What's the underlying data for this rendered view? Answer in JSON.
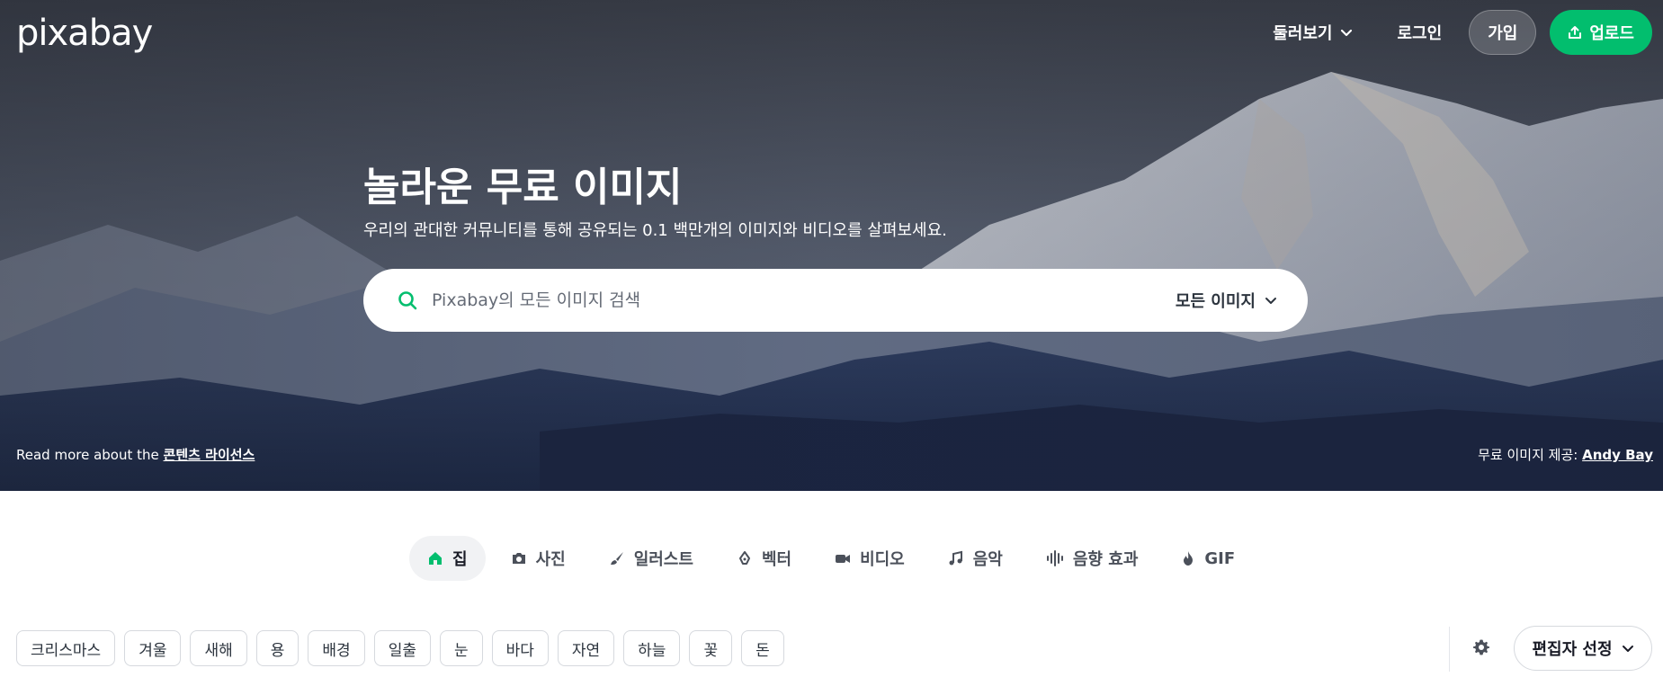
{
  "brand": {
    "logo_text": "pixabay"
  },
  "nav": {
    "explore_label": "둘러보기",
    "login_label": "로그인",
    "join_label": "가입",
    "upload_label": "업로드"
  },
  "hero": {
    "title": "놀라운 무료 이미지",
    "subtitle": "우리의 관대한 커뮤니티를 통해 공유되는 0.1 백만개의 이미지와 비디오를 살펴보세요.",
    "search": {
      "placeholder": "Pixabay의 모든 이미지 검색",
      "value": "",
      "type_selector": "모든 이미지"
    },
    "license_prefix": "Read more about the",
    "license_link": "콘텐츠 라이선스",
    "photo_credit_prefix": "무료 이미지 제공:",
    "photo_credit_author": "Andy Bay"
  },
  "tabs": [
    {
      "label": "집",
      "icon": "home-icon",
      "active": true
    },
    {
      "label": "사진",
      "icon": "camera-icon",
      "active": false
    },
    {
      "label": "일러스트",
      "icon": "brush-icon",
      "active": false
    },
    {
      "label": "벡터",
      "icon": "pen-nib-icon",
      "active": false
    },
    {
      "label": "비디오",
      "icon": "video-icon",
      "active": false
    },
    {
      "label": "음악",
      "icon": "music-note-icon",
      "active": false
    },
    {
      "label": "음향 효과",
      "icon": "sound-wave-icon",
      "active": false
    },
    {
      "label": "GIF",
      "icon": "flame-icon",
      "active": false
    }
  ],
  "chips": [
    "크리스마스",
    "겨울",
    "새해",
    "용",
    "배경",
    "일출",
    "눈",
    "바다",
    "자연",
    "하늘",
    "꽃",
    "돈"
  ],
  "sort": {
    "label": "편집자 선정"
  },
  "colors": {
    "accent": "#02be6e",
    "text": "#191b26"
  }
}
